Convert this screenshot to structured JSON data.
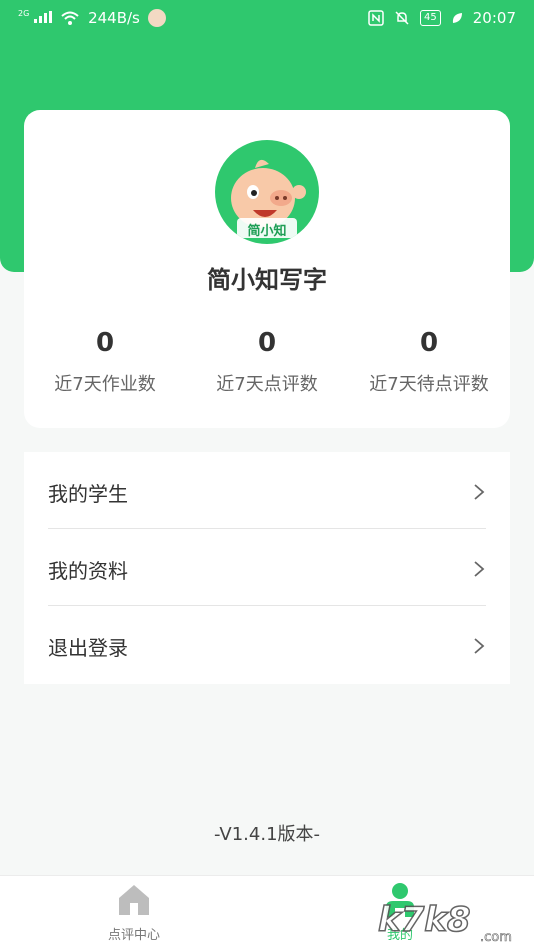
{
  "status_bar": {
    "network": "2G",
    "speed": "244B/s",
    "battery": "45",
    "time": "20:07"
  },
  "profile": {
    "avatar_text": "简小知",
    "name": "简小知写字"
  },
  "stats": [
    {
      "value": "0",
      "label": "近7天作业数"
    },
    {
      "value": "0",
      "label": "近7天点评数"
    },
    {
      "value": "0",
      "label": "近7天待点评数"
    }
  ],
  "menu": [
    {
      "label": "我的学生"
    },
    {
      "label": "我的资料"
    },
    {
      "label": "退出登录"
    }
  ],
  "version": "-V1.4.1版本-",
  "tabs": [
    {
      "label": "点评中心",
      "active": false
    },
    {
      "label": "我的",
      "active": true
    }
  ],
  "watermark": "k7k8.com",
  "colors": {
    "primary": "#2fc86e",
    "background": "#f6f8f7",
    "text": "#333333"
  }
}
